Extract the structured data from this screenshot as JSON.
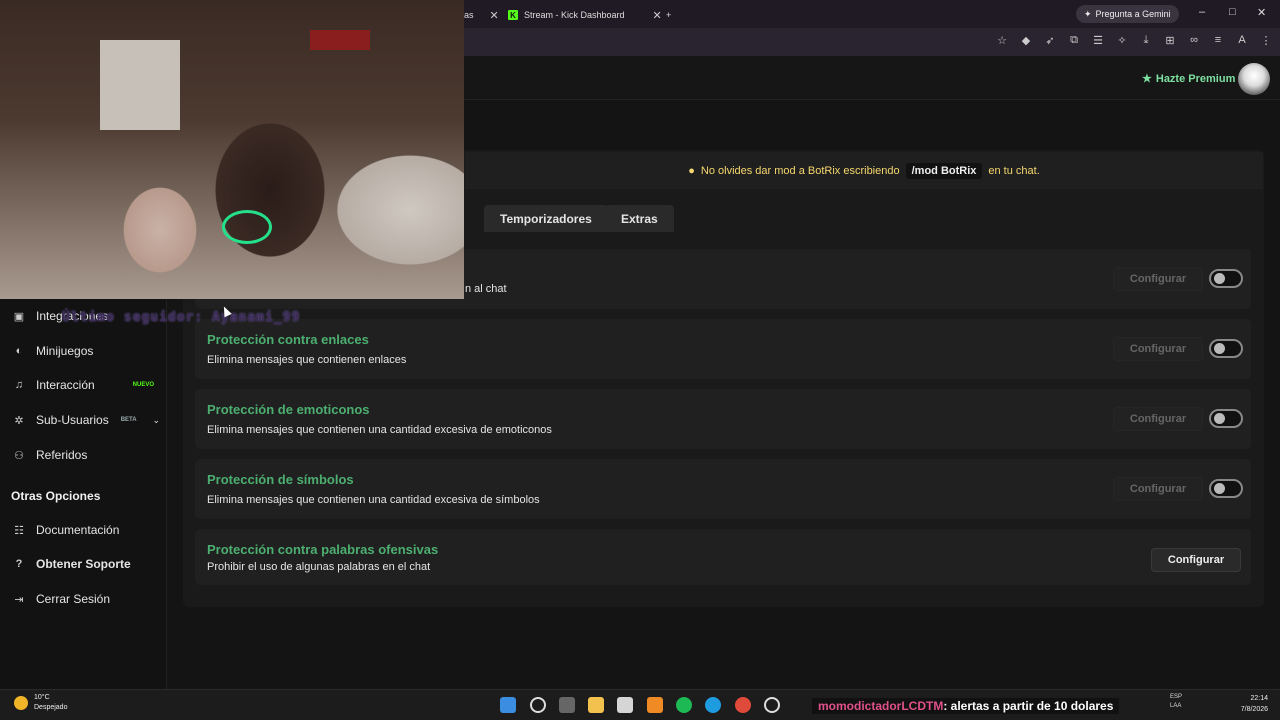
{
  "browser": {
    "tabs": [
      {
        "label": "as",
        "partial": true
      },
      {
        "label": "Stream - Kick Dashboard",
        "favicon": "K"
      }
    ],
    "gemini_button": "Pregunta a Gemini",
    "new_tab": "+",
    "window_controls": {
      "minimize": "–",
      "maximize": "□",
      "close": "✕"
    }
  },
  "header": {
    "premium_label": "Hazte Premium"
  },
  "notice": {
    "text_before": "No olvides dar mod a BotRix escribiendo",
    "command": "/mod BotRix",
    "text_after": "en tu chat."
  },
  "tabs": [
    "Temporizadores",
    "Extras"
  ],
  "rows": [
    {
      "title": "",
      "desc": "n al chat",
      "button": "Configurar",
      "toggle": false
    },
    {
      "title": "Protección contra enlaces",
      "desc": "Elimina mensajes que contienen enlaces",
      "button": "Configurar",
      "toggle": false
    },
    {
      "title": "Protección de emoticonos",
      "desc": "Elimina mensajes que contienen una cantidad excesiva de emoticonos",
      "button": "Configurar",
      "toggle": false
    },
    {
      "title": "Protección de símbolos",
      "desc": "Elimina mensajes que contienen una cantidad excesiva de símbolos",
      "button": "Configurar",
      "toggle": false
    },
    {
      "title": "Protección contra palabras ofensivas",
      "desc": "Prohibir el uso de algunas palabras en el chat",
      "button": "Configurar"
    }
  ],
  "sidebar": {
    "items": [
      {
        "label": "Integraciones",
        "icon": "integrations-icon"
      },
      {
        "label": "Minijuegos",
        "icon": "gamepad-icon"
      },
      {
        "label": "Interacción",
        "icon": "music-note-icon",
        "badge": "NUEVO"
      },
      {
        "label": "Sub-Usuarios",
        "icon": "users-icon",
        "badge": "BETA"
      },
      {
        "label": "Referidos",
        "icon": "referrals-icon"
      }
    ],
    "section_title": "Otras Opciones",
    "other": [
      {
        "label": "Documentación",
        "icon": "docs-icon"
      },
      {
        "label": "Obtener Soporte",
        "icon": "help-icon"
      },
      {
        "label": "Cerrar Sesión",
        "icon": "logout-icon"
      }
    ]
  },
  "overlay": {
    "follower_text": "Último seguidor: Ayanami_99"
  },
  "taskbar": {
    "weather_temp": "10°C",
    "weather_desc": "Despejado",
    "chat_user": "momodictadorLCDTM",
    "chat_text": ": alertas a partir de 10 dolares",
    "lang": "ESP",
    "lang2": "LAA",
    "time": "22:14",
    "date": "7/8/2026"
  }
}
